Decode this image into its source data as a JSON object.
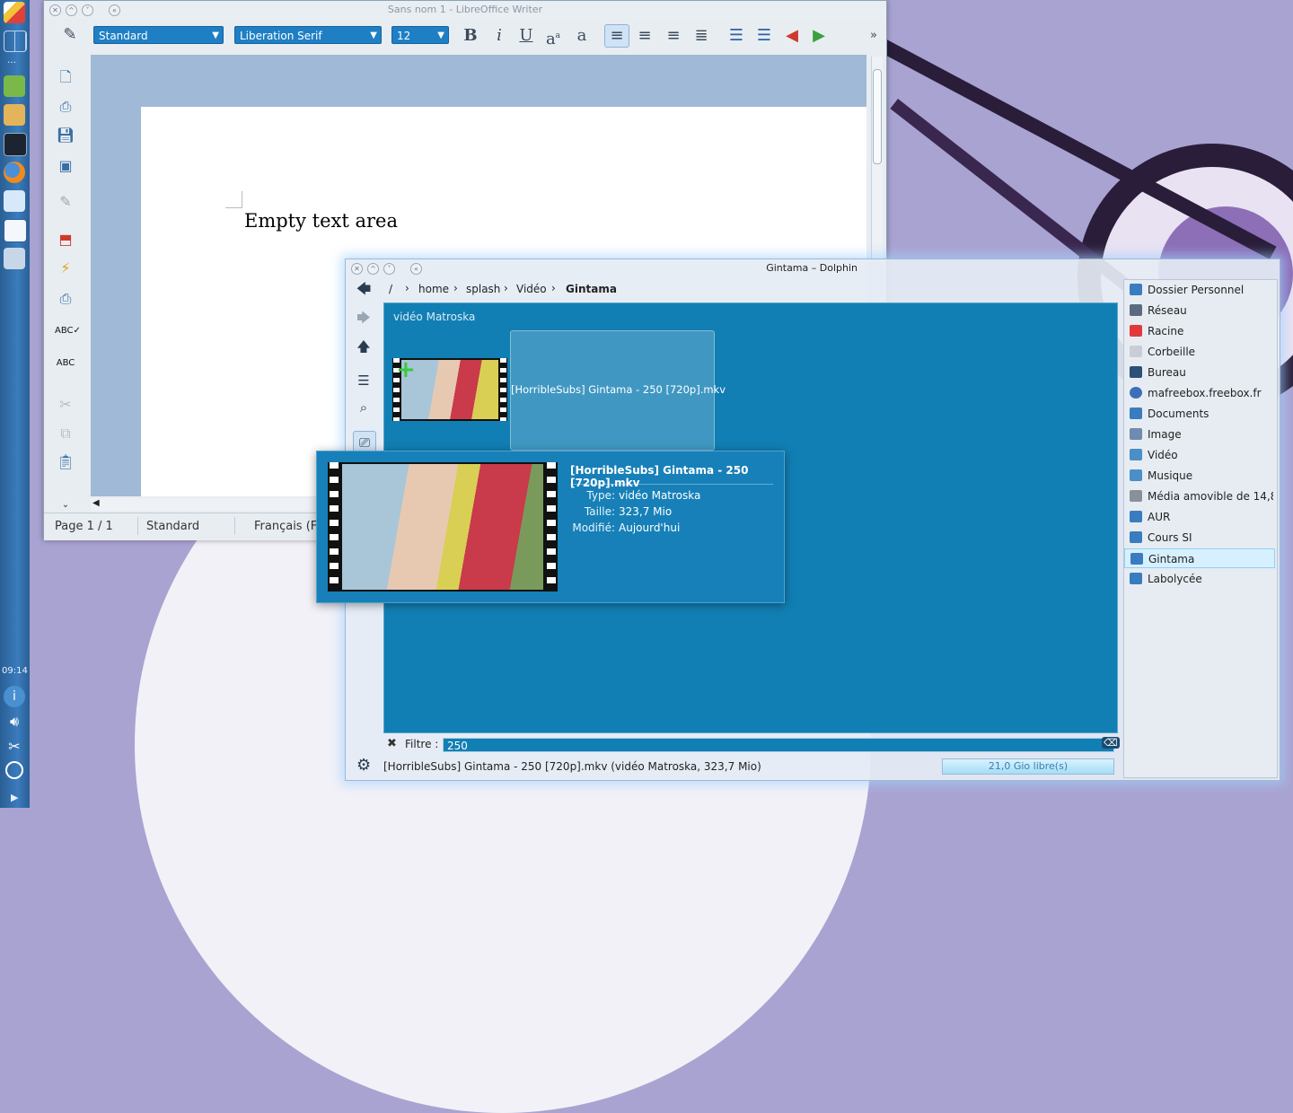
{
  "panel": {
    "clock": "09:14"
  },
  "writer": {
    "title": "Sans nom 1 - LibreOffice Writer",
    "style_combo": "Standard",
    "font_combo": "Liberation Serif",
    "size_combo": "12",
    "doc_text": "Empty text area",
    "status": {
      "page": "Page 1 / 1",
      "style": "Standard",
      "language": "Français (F"
    }
  },
  "dolphin": {
    "title": "Gintama – Dolphin",
    "breadcrumb": [
      "/",
      "home",
      "splash",
      "Vidéo",
      "Gintama"
    ],
    "group_title": "vidéo Matroska",
    "file_name": "[HorribleSubs] Gintama - 250 [720p].mkv",
    "tooltip": {
      "name": "[HorribleSubs] Gintama - 250 [720p].mkv",
      "type_label": "Type:",
      "type_value": "vidéo Matroska",
      "size_label": "Taille:",
      "size_value": "323,7 Mio",
      "modified_label": "Modifié:",
      "modified_value": "Aujourd'hui"
    },
    "filter_label": "Filtre :",
    "filter_value": "250",
    "status_text": "[HorribleSubs] Gintama - 250 [720p].mkv (vidéo Matroska, 323,7 Mio)",
    "free_space": "21,0 Gio libre(s)",
    "free_space_fraction": 0.0,
    "places": [
      "Dossier Personnel",
      "Réseau",
      "Racine",
      "Corbeille",
      "Bureau",
      "mafreebox.freebox.fr",
      "Documents",
      "Image",
      "Vidéo",
      "Musique",
      "Média amovible de 14,8 …",
      "AUR",
      "Cours SI",
      "Gintama",
      "Labolycée"
    ],
    "active_place": "Gintama"
  },
  "colors": {
    "accent": "#117fb3",
    "panel": "#2f6fa8",
    "wallpaper": "#a9a3d1"
  }
}
